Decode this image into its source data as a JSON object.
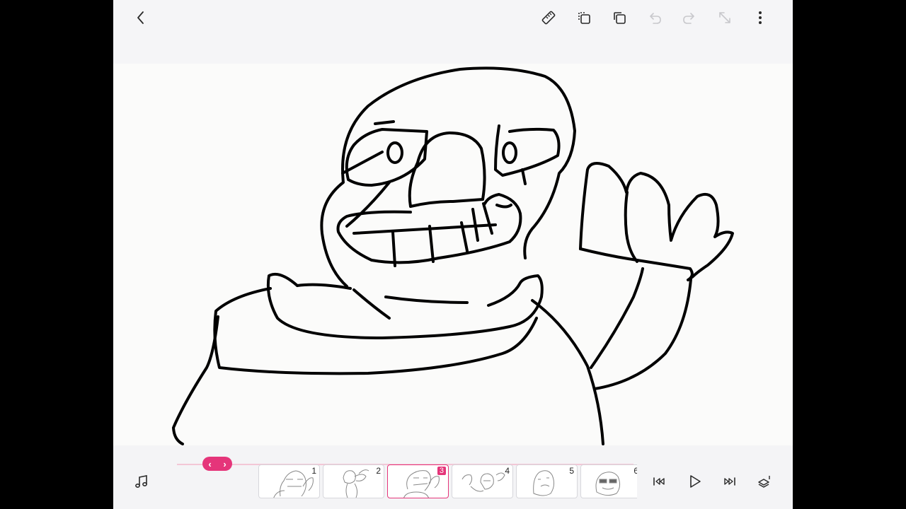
{
  "frames": [
    {
      "number": "1"
    },
    {
      "number": "2"
    },
    {
      "number": "3",
      "active": true
    },
    {
      "number": "4"
    },
    {
      "number": "5"
    },
    {
      "number": "6"
    }
  ],
  "scrubber": {
    "left": "‹",
    "right": "›"
  },
  "colors": {
    "accent": "#e5357a",
    "ink": "#000000",
    "icon": "#2a2a2a",
    "disabled_icon": "#c8c8cc"
  }
}
